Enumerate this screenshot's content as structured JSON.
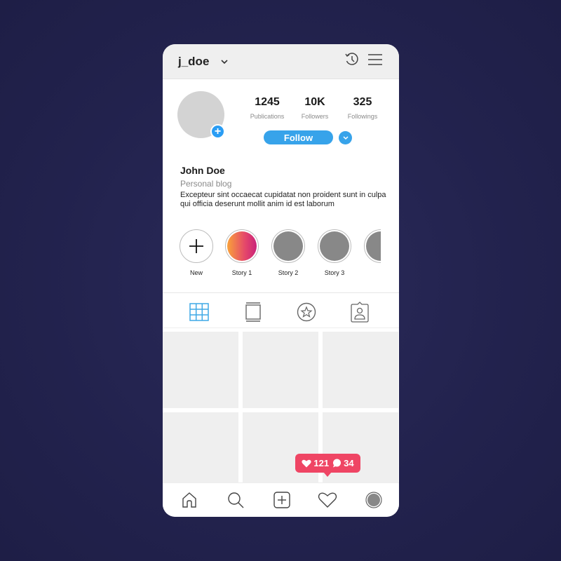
{
  "header": {
    "username": "j_doe",
    "icons": [
      "chevron-down-icon",
      "history-icon",
      "menu-icon"
    ]
  },
  "profile": {
    "stats": [
      {
        "value": "1245",
        "label": "Publications"
      },
      {
        "value": "10K",
        "label": "Followers"
      },
      {
        "value": "325",
        "label": "Followings"
      }
    ],
    "follow_label": "Follow",
    "name": "John Doe",
    "category": "Personal blog",
    "bio": "Excepteur sint occaecat cupidatat non proident sunt in culpa qui officia deserunt mollit anim id est laborum"
  },
  "stories": [
    {
      "label": "New",
      "type": "add"
    },
    {
      "label": "Story 1",
      "type": "gradient"
    },
    {
      "label": "Story 2",
      "type": "gray"
    },
    {
      "label": "Story 3",
      "type": "gray"
    },
    {
      "label": "",
      "type": "gray"
    }
  ],
  "tabs": [
    "grid-icon",
    "feed-icon",
    "star-icon",
    "tagged-icon"
  ],
  "notification": {
    "likes": "121",
    "comments": "34"
  },
  "bottom_nav": [
    "home-icon",
    "search-icon",
    "add-post-icon",
    "activity-heart-icon",
    "profile-avatar-icon"
  ],
  "colors": {
    "accent": "#37a3ea",
    "notification": "#ef4564",
    "background": "#22224d"
  }
}
